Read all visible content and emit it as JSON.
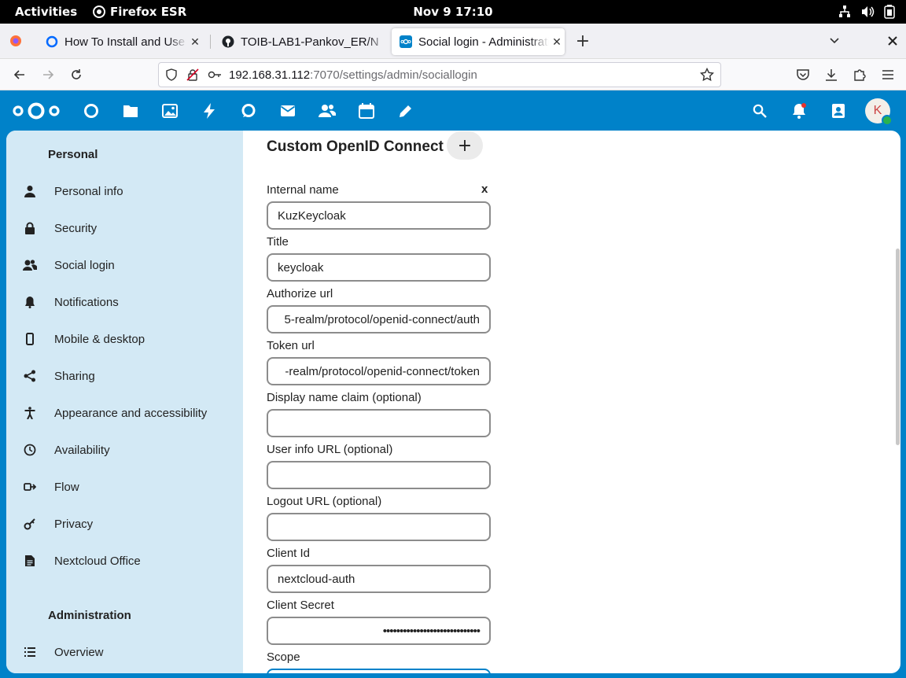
{
  "system_bar": {
    "activities": "Activities",
    "app_name": "Firefox ESR",
    "clock": "Nov 9  17:10",
    "tray_icons": [
      "network-icon",
      "volume-icon",
      "battery-icon"
    ]
  },
  "browser": {
    "tabs": [
      {
        "label": "How To Install and Use Do",
        "icon": "digitalocean-icon",
        "active": false
      },
      {
        "label": "TOIB-LAB1-Pankov_ER/N",
        "icon": "github-icon",
        "active": false
      },
      {
        "label": "Social login - Administrati",
        "icon": "nextcloud-icon",
        "active": true
      }
    ],
    "new_tab_label": "+",
    "url_host": "192.168.31.112",
    "url_path": ":7070/settings/admin/sociallogin"
  },
  "nextcloud": {
    "apps": [
      "dashboard-icon",
      "files-icon",
      "photos-icon",
      "activity-icon",
      "talk-icon",
      "mail-icon",
      "contacts-icon",
      "calendar-icon",
      "notes-icon"
    ],
    "avatar_initial": "K",
    "sidebar": {
      "personal_heading": "Personal",
      "personal_items": [
        {
          "label": "Personal info",
          "icon": "user-icon"
        },
        {
          "label": "Security",
          "icon": "lock-icon"
        },
        {
          "label": "Social login",
          "icon": "group-icon"
        },
        {
          "label": "Notifications",
          "icon": "bell-icon"
        },
        {
          "label": "Mobile & desktop",
          "icon": "phone-icon"
        },
        {
          "label": "Sharing",
          "icon": "share-icon"
        },
        {
          "label": "Appearance and accessibility",
          "icon": "accessibility-icon"
        },
        {
          "label": "Availability",
          "icon": "clock-icon"
        },
        {
          "label": "Flow",
          "icon": "flow-icon"
        },
        {
          "label": "Privacy",
          "icon": "key-icon"
        },
        {
          "label": "Nextcloud Office",
          "icon": "document-icon"
        }
      ],
      "admin_heading": "Administration",
      "admin_items": [
        {
          "label": "Overview",
          "icon": "list-icon"
        }
      ]
    },
    "form": {
      "section_title": "Custom OpenID Connect",
      "add_label": "+",
      "remove_label": "x",
      "fields": [
        {
          "label": "Internal name",
          "value": "KuzKeycloak"
        },
        {
          "label": "Title",
          "value": "keycloak"
        },
        {
          "label": "Authorize url",
          "value": "5-realm/protocol/openid-connect/auth"
        },
        {
          "label": "Token url",
          "value": "-realm/protocol/openid-connect/token"
        },
        {
          "label": "Display name claim (optional)",
          "value": ""
        },
        {
          "label": "User info URL (optional)",
          "value": ""
        },
        {
          "label": "Logout URL (optional)",
          "value": ""
        },
        {
          "label": "Client Id",
          "value": "nextcloud-auth"
        },
        {
          "label": "Client Secret",
          "value": "•••••••••••••••••••••••••••••"
        },
        {
          "label": "Scope",
          "value": ""
        }
      ]
    }
  }
}
